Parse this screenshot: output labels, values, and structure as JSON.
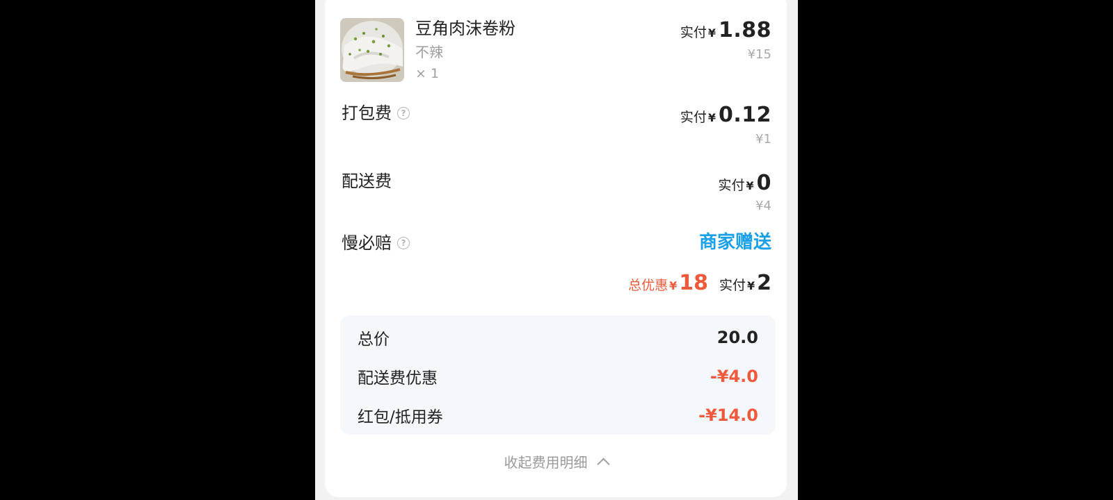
{
  "item": {
    "name": "豆角肉沫卷粉",
    "spec": "不辣",
    "quantity": "× 1",
    "paid_label": "实付",
    "currency": "¥",
    "paid_amount": "1.88",
    "original_price": "¥15"
  },
  "packing_fee": {
    "label": "打包费",
    "paid_label": "实付",
    "currency": "¥",
    "paid_amount": "0.12",
    "original_price": "¥1"
  },
  "delivery_fee": {
    "label": "配送费",
    "paid_label": "实付",
    "currency": "¥",
    "paid_amount": "0",
    "original_price": "¥4"
  },
  "late_compensation": {
    "label": "慢必赔",
    "value": "商家赠送"
  },
  "totals": {
    "discount_label": "总优惠",
    "discount_currency": "¥",
    "discount_amount": "18",
    "paid_label": "实付",
    "paid_currency": "¥",
    "paid_amount": "2"
  },
  "breakdown": [
    {
      "label": "总价",
      "value": "20.0"
    },
    {
      "label": "配送费优惠",
      "value": "-¥4.0"
    },
    {
      "label": "红包/抵用券",
      "value": "-¥14.0"
    }
  ],
  "collapse_label": "收起费用明细",
  "colors": {
    "accent_blue": "#1aa0e8",
    "discount_red": "#ef5a3c"
  }
}
